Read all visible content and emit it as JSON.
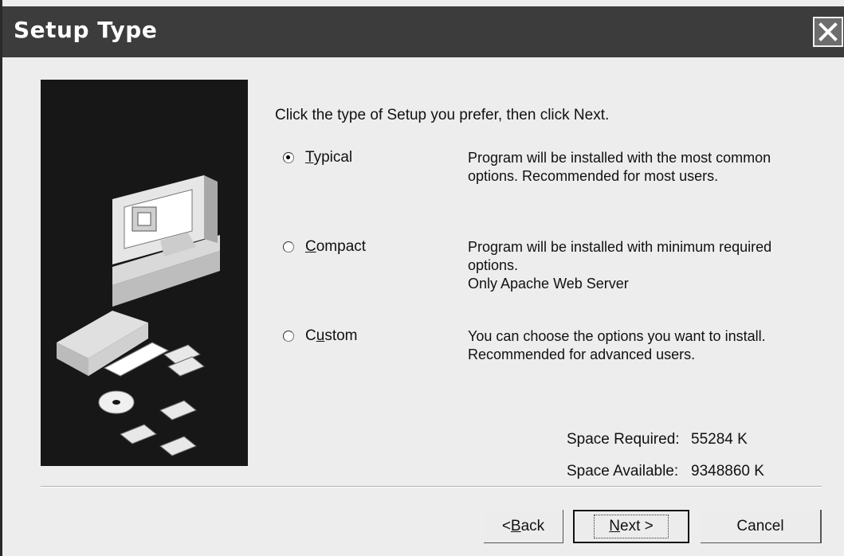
{
  "window": {
    "title": "Setup Type",
    "close_icon": "close-icon"
  },
  "prompt": "Click the type of Setup you prefer, then click Next.",
  "options": [
    {
      "label_mnemonic": "T",
      "label_rest": "ypical",
      "selected": true,
      "description": "Program will be installed with the most common options. Recommended for most users."
    },
    {
      "label_mnemonic": "C",
      "label_rest": "ompact",
      "selected": false,
      "description": "Program will be installed with minimum required options.",
      "description_line2": "Only Apache Web Server"
    },
    {
      "label_pre": "C",
      "label_mnemonic": "u",
      "label_rest": "stom",
      "selected": false,
      "description": "You can choose the options you want to install. Recommended for advanced users."
    }
  ],
  "space": {
    "required_label": "Space Required:",
    "required_value": "55284 K",
    "available_label": "Space Available:",
    "available_value": "9348860 K"
  },
  "buttons": {
    "back_pre": "< ",
    "back_mnemonic": "B",
    "back_rest": "ack",
    "next_mnemonic": "N",
    "next_rest": "ext >",
    "cancel": "Cancel"
  },
  "illustration_icons": [
    "computer-icon",
    "cd-drive-icon",
    "floppy-disk-icon",
    "cd-icon"
  ]
}
